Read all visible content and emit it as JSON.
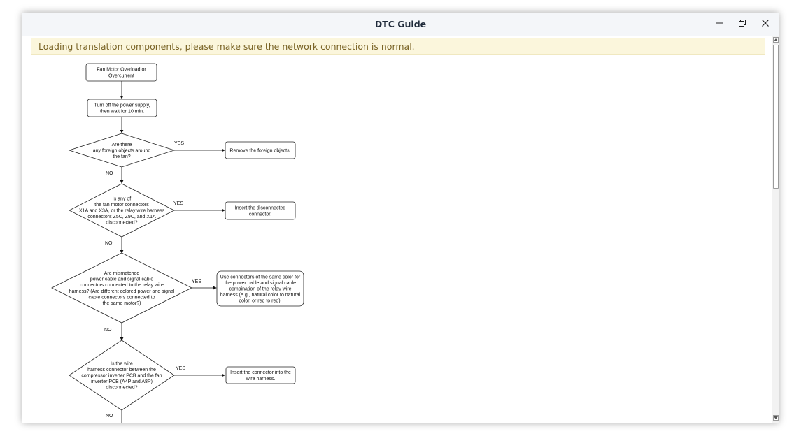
{
  "window": {
    "title": "DTC Guide",
    "controls": {
      "minimize_icon": "minimize-icon",
      "restore_icon": "restore-icon",
      "close_icon": "close-icon"
    }
  },
  "banner": {
    "text": "Loading translation components, please make sure the network connection is normal.",
    "background": "#fbf6dc",
    "text_color": "#7a6426"
  },
  "flowchart": {
    "start_box": [
      "Fan Motor Overload or",
      "Overcurrent"
    ],
    "step1": [
      "Turn off the power supply,",
      "then wait for 10 min."
    ],
    "q1": [
      "Are there",
      "any foreign objects around",
      "the fan?"
    ],
    "a1": [
      "Remove the foreign objects."
    ],
    "q2": [
      "Is any of",
      "the fan motor connectors",
      "X1A and X3A, or the relay wire harness",
      "connectors Z5C, Z9C, and X1A",
      "disconnected?"
    ],
    "a2": [
      "Insert the disconnected",
      "connector."
    ],
    "q3": [
      "Are mismatched",
      "power cable and signal cable",
      "connectors connected to the relay wire",
      "harness? (Are different colored power and signal",
      "cable connectors connected to",
      "the same motor?)"
    ],
    "a3": [
      "Use connectors of the same color for",
      "the power cable and signal cable",
      "combination of the relay wire",
      "harness (e.g., natural color to natural",
      "color, or red to red)."
    ],
    "q4": [
      "Is the wire",
      "harness connector between the",
      "compressor inverter PCB and the fan",
      "inverter PCB (A4P and A8P)",
      "disconnected?"
    ],
    "a4": [
      "Insert the connector into the",
      "wire harness."
    ],
    "yes_label": "YES",
    "no_label": "NO"
  }
}
